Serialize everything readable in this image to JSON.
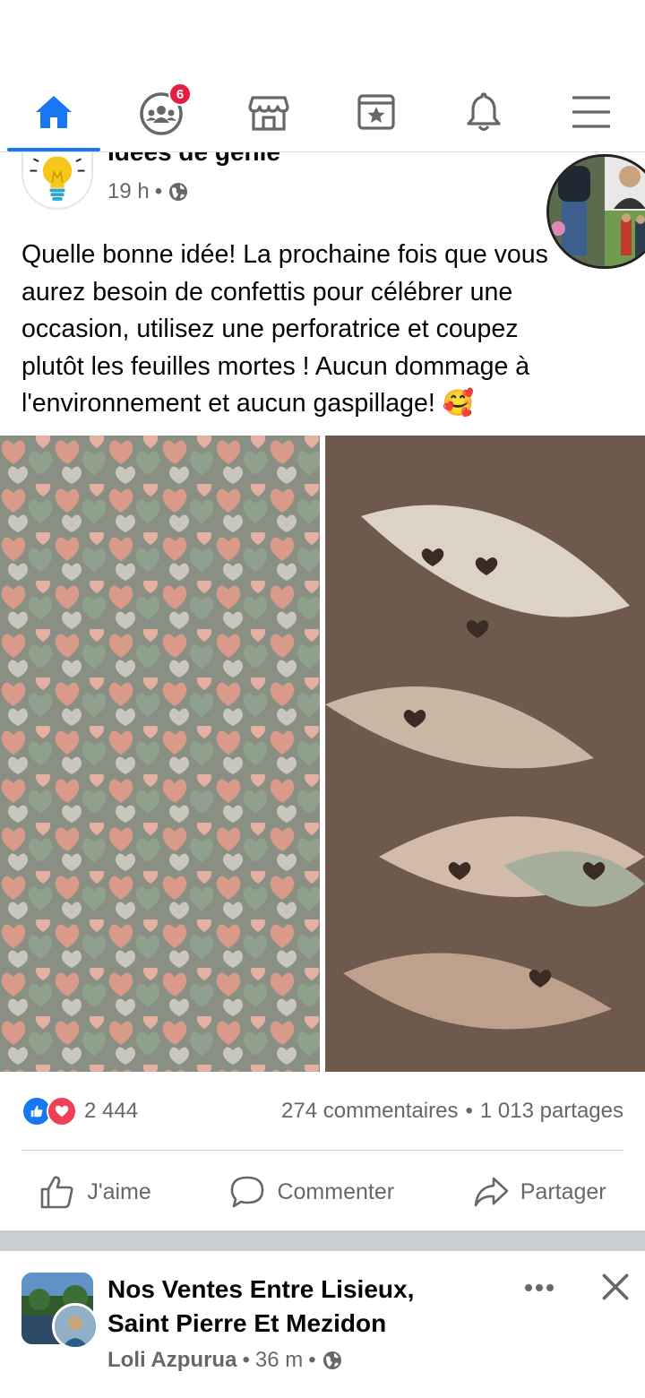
{
  "nav": {
    "items": [
      {
        "icon": "home-icon",
        "active": true
      },
      {
        "icon": "groups-icon",
        "badge": "6"
      },
      {
        "icon": "marketplace-icon"
      },
      {
        "icon": "pages-icon"
      },
      {
        "icon": "notifications-icon"
      },
      {
        "icon": "menu-icon"
      }
    ],
    "accent": "#1877f2",
    "badge_color": "#e41e3f"
  },
  "post": {
    "page_name": "Idées de génie",
    "time": "19 h",
    "separator": "•",
    "privacy_icon": "globe-icon",
    "text_lines": [
      "Quelle bonne idée! La prochaine fois que vous",
      "aurez besoin de confettis pour célébrer une",
      "occasion, utilisez une perforatrice et coupez",
      "plutôt les feuilles mortes ! Aucun dommage à",
      "l'environnement et aucun gaspillage! 🥰"
    ],
    "stats": {
      "reaction_count": "2 444",
      "comments": "274 commentaires",
      "dot": "•",
      "shares": "1 013 partages"
    },
    "actions": {
      "like": "J'aime",
      "comment": "Commenter",
      "share": "Partager"
    }
  },
  "post2": {
    "group_title_line1": "Nos Ventes Entre Lisieux,",
    "group_title_line2": "Saint Pierre Et Mezidon",
    "author": "Loli Azpurua",
    "separator": "•",
    "time": "36 m",
    "privacy_icon": "globe-icon"
  }
}
